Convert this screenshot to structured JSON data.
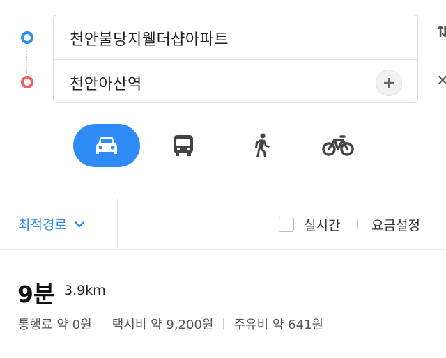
{
  "route_inputs": {
    "origin": "천안불당지웰더샵아파트",
    "destination": "천안아산역"
  },
  "icons": {
    "swap": "swap-arrows-icon",
    "close": "close-icon",
    "add": "plus-icon",
    "car": "car-icon",
    "bus": "bus-icon",
    "walk": "walk-icon",
    "bike": "bicycle-icon",
    "chevron": "chevron-down-icon"
  },
  "transport_modes": {
    "selected": "car"
  },
  "options": {
    "route_type": "최적경로",
    "realtime_label": "실시간",
    "fare_setting": "요금설정"
  },
  "summary": {
    "time": "9분",
    "distance": "3.9km",
    "toll": "통행료 약 0원",
    "taxi": "택시비 약 9,200원",
    "fuel": "주유비 약 641원"
  },
  "colors": {
    "accent": "#2f8bf5",
    "destination": "#f25f5c"
  }
}
